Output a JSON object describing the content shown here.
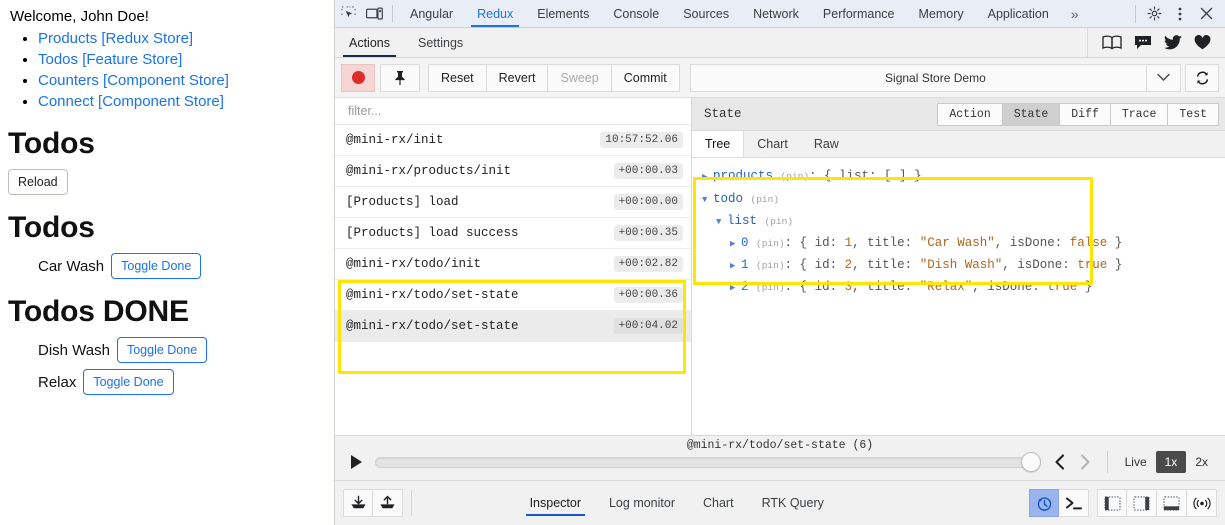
{
  "page": {
    "welcome": "Welcome, John Doe!",
    "links": [
      "Products [Redux Store]",
      "Todos [Feature Store]",
      "Counters [Component Store]",
      "Connect [Component Store]"
    ],
    "heading_todos": "Todos",
    "reload_label": "Reload",
    "heading_todos_2": "Todos",
    "heading_todos_done": "Todos DONE",
    "open_todos": [
      {
        "title": "Car Wash",
        "button": "Toggle Done"
      }
    ],
    "done_todos": [
      {
        "title": "Dish Wash",
        "button": "Toggle Done"
      },
      {
        "title": "Relax",
        "button": "Toggle Done"
      }
    ]
  },
  "devtools": {
    "top_tabs": [
      {
        "label": "Angular",
        "active": false
      },
      {
        "label": "Redux",
        "active": true
      },
      {
        "label": "Elements",
        "active": false
      },
      {
        "label": "Console",
        "active": false
      },
      {
        "label": "Sources",
        "active": false
      },
      {
        "label": "Network",
        "active": false
      },
      {
        "label": "Performance",
        "active": false
      },
      {
        "label": "Memory",
        "active": false
      },
      {
        "label": "Application",
        "active": false
      }
    ],
    "overflow_label": "»",
    "icons": {
      "inspect": "inspect-element-icon",
      "device": "device-toolbar-icon",
      "settings": "gear-icon",
      "kebab": "more-options-icon",
      "close": "close-icon"
    }
  },
  "redux": {
    "sub_tabs": [
      {
        "label": "Actions",
        "active": true
      },
      {
        "label": "Settings",
        "active": false
      }
    ],
    "sub_right_icons": [
      "book-icon",
      "chat-icon",
      "twitter-icon",
      "heart-icon"
    ],
    "toolbar": {
      "record_label": "record-button",
      "pin_label": "pin-button",
      "reset": "Reset",
      "revert": "Revert",
      "sweep": "Sweep",
      "commit": "Commit",
      "instance": "Signal Store Demo",
      "refresh": "refresh-icon"
    },
    "filter_placeholder": "filter...",
    "actions": [
      {
        "name": "@mini-rx/init",
        "time": "10:57:52.06",
        "selected": false,
        "highlighted": false
      },
      {
        "name": "@mini-rx/products/init",
        "time": "+00:00.03",
        "selected": false,
        "highlighted": false
      },
      {
        "name": "[Products] load",
        "time": "+00:00.00",
        "selected": false,
        "highlighted": false
      },
      {
        "name": "[Products] load success",
        "time": "+00:00.35",
        "selected": false,
        "highlighted": false
      },
      {
        "name": "@mini-rx/todo/init",
        "time": "+00:02.82",
        "selected": false,
        "highlighted": true
      },
      {
        "name": "@mini-rx/todo/set-state",
        "time": "+00:00.36",
        "selected": false,
        "highlighted": true
      },
      {
        "name": "@mini-rx/todo/set-state",
        "time": "+00:04.02",
        "selected": true,
        "highlighted": true
      }
    ],
    "state_panel": {
      "title": "State",
      "segments": [
        {
          "label": "Action",
          "active": false
        },
        {
          "label": "State",
          "active": true
        },
        {
          "label": "Diff",
          "active": false
        },
        {
          "label": "Trace",
          "active": false
        },
        {
          "label": "Test",
          "active": false
        }
      ],
      "view_tabs": [
        {
          "label": "Tree",
          "active": true
        },
        {
          "label": "Chart",
          "active": false
        },
        {
          "label": "Raw",
          "active": false
        }
      ],
      "tree": {
        "products": {
          "key": "products",
          "pin": "(pin)",
          "value": ": { list: […] }"
        },
        "todo": {
          "key": "todo",
          "pin": "(pin)"
        },
        "list": {
          "key": "list",
          "pin": "(pin)"
        },
        "items": [
          {
            "index": "0",
            "pin": "(pin)",
            "sep": ": {",
            "f1k": "id:",
            "f1v": "1",
            "f2k": "title:",
            "f2v": "\"Car Wash\"",
            "f3k": "isDone:",
            "f3v": "false",
            "end": "}"
          },
          {
            "index": "1",
            "pin": "(pin)",
            "sep": ": {",
            "f1k": "id:",
            "f1v": "2",
            "f2k": "title:",
            "f2v": "\"Dish Wash\"",
            "f3k": "isDone:",
            "f3v": "true",
            "end": "}"
          },
          {
            "index": "2",
            "pin": "(pin)",
            "sep": ": {",
            "f1k": "id:",
            "f1v": "3",
            "f2k": "title:",
            "f2v": "\"Relax\"",
            "f3k": "isDone:",
            "f3v": "true",
            "end": "}"
          }
        ]
      }
    },
    "slider": {
      "label": "@mini-rx/todo/set-state (6)",
      "play": "play-icon",
      "prev": "previous-action-icon",
      "next": "next-action-icon",
      "live": "Live",
      "speed_1x": "1x",
      "speed_2x": "2x",
      "active_speed": "1x"
    },
    "bottom": {
      "import_icon": "import-icon",
      "export_icon": "export-icon",
      "monitor_tabs": [
        {
          "label": "Inspector",
          "active": true
        },
        {
          "label": "Log monitor",
          "active": false
        },
        {
          "label": "Chart",
          "active": false
        },
        {
          "label": "RTK Query",
          "active": false
        }
      ],
      "right_icons": [
        {
          "name": "time-travel-icon",
          "selected": true
        },
        {
          "name": "terminal-icon",
          "selected": false
        },
        {
          "name": "dock-left-icon",
          "selected": false
        },
        {
          "name": "dock-right-icon",
          "selected": false
        },
        {
          "name": "dock-bottom-icon",
          "selected": false
        },
        {
          "name": "remote-icon",
          "selected": false
        }
      ]
    }
  },
  "colors": {
    "link": "#1a73e8",
    "highlight": "#ffe600",
    "accent": "#1a73e8",
    "record": "#e02b2b"
  }
}
